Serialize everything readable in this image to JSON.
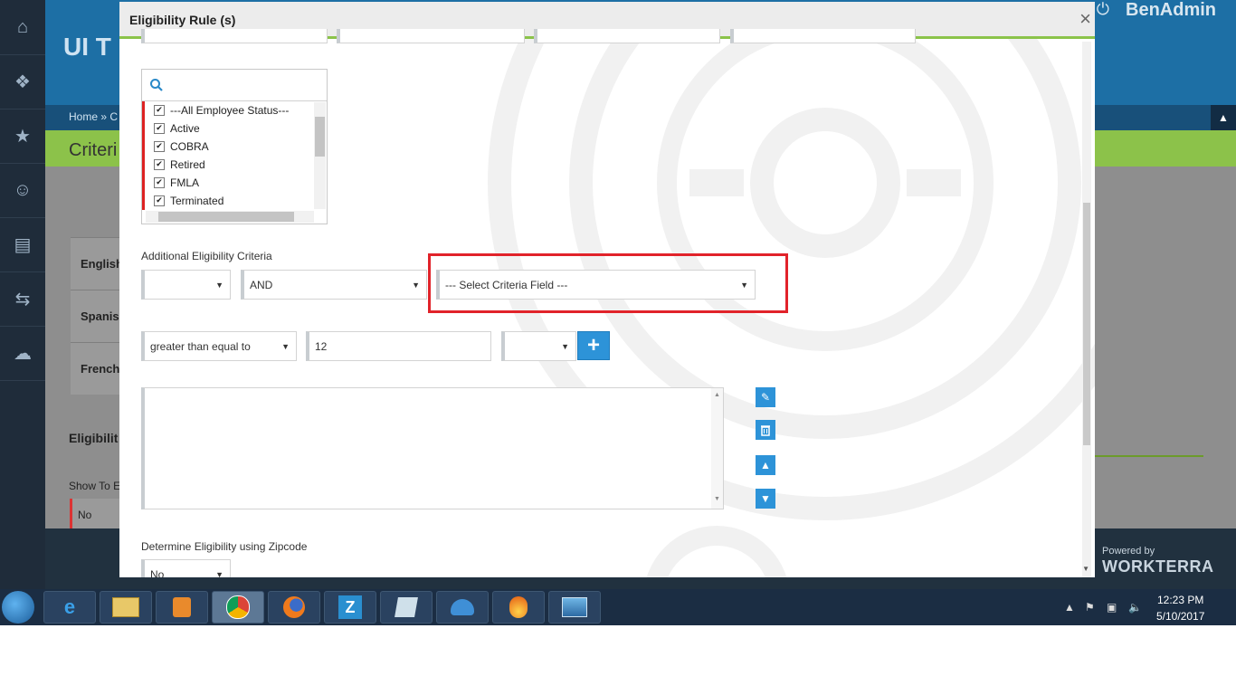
{
  "background_app": {
    "title_partial": "UI T",
    "brand": "BenAdmin",
    "breadcrumb_home": "Home",
    "breadcrumb_sep": "»",
    "breadcrumb_next": "C",
    "collapse_icon": "chevron-up-icon",
    "page_heading_partial": "Criteri",
    "rows": [
      "English",
      "Spanish",
      "French"
    ],
    "section_title_partial": "Eligibilit",
    "show_label_partial": "Show To E",
    "show_value": "No",
    "powered_by": "Powered by",
    "powered_brand": "WORKTERRA"
  },
  "modal": {
    "title": "Eligibility Rule (s)",
    "close_label": "×",
    "status_list": {
      "search_placeholder": "",
      "items": [
        {
          "label": "---All Employee Status---",
          "checked": true
        },
        {
          "label": "Active",
          "checked": true
        },
        {
          "label": "COBRA",
          "checked": true
        },
        {
          "label": "Retired",
          "checked": true
        },
        {
          "label": "FMLA",
          "checked": true
        },
        {
          "label": "Terminated",
          "checked": true
        }
      ]
    },
    "additional_criteria_label": "Additional Eligibility Criteria",
    "paren_select_value": "",
    "logic_select_value": "AND",
    "criteria_field_value": "--- Select Criteria Field ---",
    "operator_value": "greater than equal to",
    "value_input": "12",
    "close_paren_value": "",
    "add_button_label": "+",
    "rule_text": "",
    "zipcode_label": "Determine Eligibility using Zipcode",
    "zipcode_value": "No"
  },
  "taskbar": {
    "apps": [
      "ie-icon",
      "file-explorer-icon",
      "media-player-icon",
      "chrome-icon",
      "firefox-icon",
      "z-app-icon",
      "notepad-icon",
      "thunderbird-icon",
      "flame-app-icon",
      "photo-viewer-icon"
    ],
    "active_app": "chrome-icon",
    "time": "12:23 PM",
    "date": "5/10/2017"
  },
  "colors": {
    "accent_green": "#8bc34a",
    "primary_blue": "#2d93d8",
    "highlight_red": "#e1232a",
    "header_blue": "#1d6fa5"
  }
}
